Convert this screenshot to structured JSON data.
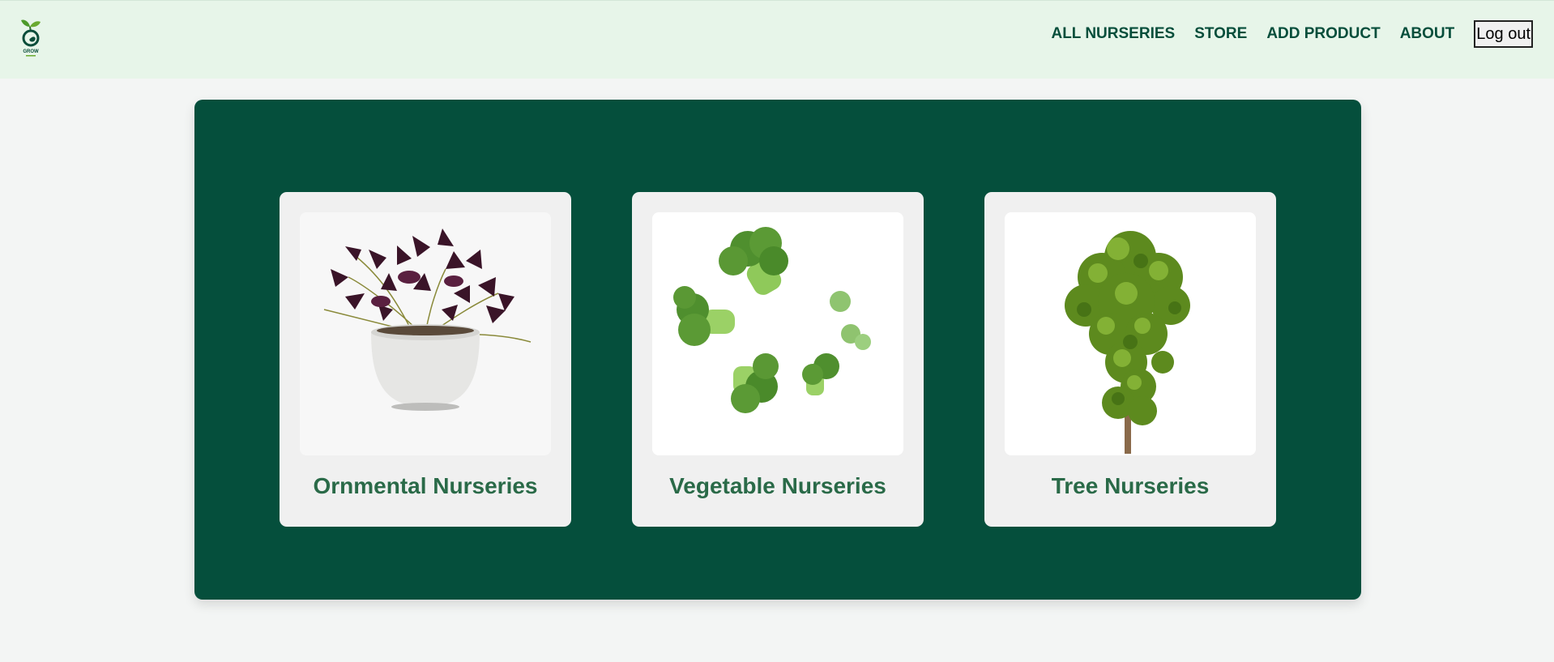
{
  "nav": {
    "logo_icon": "grow-leaf-logo-icon",
    "logo_text": "GROW",
    "links": [
      "ALL NURSERIES",
      "STORE",
      "ADD PRODUCT",
      "ABOUT"
    ],
    "logout_label": "Log out"
  },
  "cards": [
    {
      "title": "Ornmental Nurseries",
      "image": "potted-purple-shamrock-plant"
    },
    {
      "title": "Vegetable Nurseries",
      "image": "floating-broccoli-florets"
    },
    {
      "title": "Tree Nurseries",
      "image": "green-tree"
    }
  ],
  "colors": {
    "navbar_bg": "#e7f5e9",
    "nav_text": "#064e3b",
    "panel_bg": "#054f3c",
    "card_bg": "#f0f0f0",
    "card_title": "#2a6a48",
    "page_bg": "#f3f5f4"
  }
}
